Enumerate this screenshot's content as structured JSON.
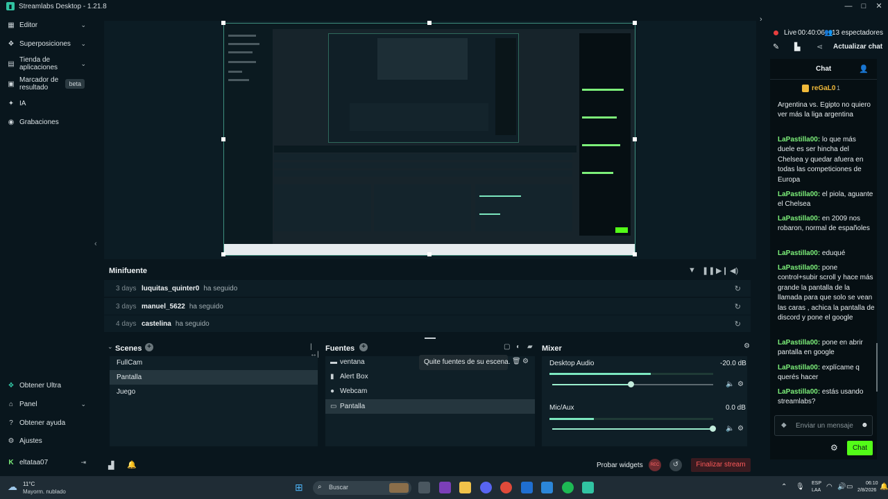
{
  "app": {
    "title": "Streamlabs Desktop - 1.21.8",
    "window_controls": {
      "minimize": "—",
      "maximize": "□",
      "close": "✕"
    }
  },
  "sidebar": {
    "items": [
      {
        "label": "Editor",
        "icon": "grid-icon",
        "glyph": "▦",
        "chevron": "⌄"
      },
      {
        "label": "Superposiciones",
        "icon": "layers-icon",
        "glyph": "❖",
        "chevron": "⌄"
      },
      {
        "label": "Tienda de aplicaciones",
        "icon": "store-icon",
        "glyph": "▤",
        "chevron": "⌄"
      },
      {
        "label": "Marcador de resultado",
        "icon": "highlight-icon",
        "glyph": "▣",
        "badge": "beta"
      },
      {
        "label": "IA",
        "icon": "sparkle-icon",
        "glyph": "✦"
      },
      {
        "label": "Grabaciones",
        "icon": "record-icon",
        "glyph": "◉"
      }
    ],
    "bottom_items": [
      {
        "label": "Obtener Ultra",
        "icon": "ultra-icon",
        "glyph": "❖"
      },
      {
        "label": "Panel",
        "icon": "dashboard-icon",
        "glyph": "⌂",
        "chevron": "⌄"
      },
      {
        "label": "Obtener ayuda",
        "icon": "help-icon",
        "glyph": "?"
      },
      {
        "label": "Ajustes",
        "icon": "gear-icon",
        "glyph": "⚙"
      }
    ],
    "user": {
      "name": "eltataa07",
      "logout_glyph": "⇥"
    }
  },
  "minifeed": {
    "title": "Minifuente",
    "rows": [
      {
        "ago": "3 days",
        "user": "luquitas_quinter0",
        "action": "ha seguido"
      },
      {
        "ago": "3 days",
        "user": "manuel_5622",
        "action": "ha seguido"
      },
      {
        "ago": "4 days",
        "user": "castelina",
        "action": "ha seguido"
      }
    ]
  },
  "scenes": {
    "title": "Scenes",
    "items": [
      "FullCam",
      "Pantalla",
      "Juego"
    ],
    "selected": "Pantalla"
  },
  "sources": {
    "title": "Fuentes",
    "items": [
      {
        "label": "ventana",
        "icon": "window-icon",
        "glyph": "▬"
      },
      {
        "label": "Alert Box",
        "icon": "alertbox-icon",
        "glyph": "▮"
      },
      {
        "label": "Webcam",
        "icon": "webcam-icon",
        "glyph": "●"
      },
      {
        "label": "Pantalla",
        "icon": "monitor-icon",
        "glyph": "▭"
      }
    ],
    "selected": "Pantalla",
    "tooltip": "Quite fuentes de su escena."
  },
  "mixer": {
    "title": "Mixer",
    "channels": [
      {
        "name": "Desktop Audio",
        "db": "-20.0 dB",
        "level": 0.62,
        "volume": 0.49
      },
      {
        "name": "Mic/Aux",
        "db": "0.0 dB",
        "level": 0.27,
        "volume": 1.0
      }
    ]
  },
  "bottombar": {
    "test_widgets": "Probar widgets",
    "rec": "REC",
    "end_stream": "Finalizar stream"
  },
  "stream": {
    "status": "Live",
    "time": "00:40:06",
    "viewers": "13 espectadores",
    "refresh_chat": "Actualizar chat"
  },
  "chat": {
    "title": "Chat",
    "pinned_user": "reGaL0",
    "pinned_count": "1",
    "pinned_text": "Argentina vs. Egipto no quiero ver más la liga argentina",
    "messages": [
      {
        "nick": "LaPastilla00:",
        "text": " lo que más duele es ser hincha del Chelsea y quedar afuera en todas las competiciones de Europa"
      },
      {
        "nick": "LaPastilla00:",
        "text": " el piola, aguante el Chelsea"
      },
      {
        "nick": "LaPastilla00:",
        "text": " en 2009 nos robaron, normal de españoles"
      },
      {
        "nick": "LaPastilla00:",
        "text": " eduqué"
      },
      {
        "nick": "LaPastilla00:",
        "text": " pone control+subir scroll y hace más grande la pantalla de la llamada para que solo se vean las caras , achica la pantalla de discord y pone el google"
      },
      {
        "nick": "LaPastilla00:",
        "text": " pone en abrir pantalla en google"
      },
      {
        "nick": "LaPastilla00:",
        "text": " explícame q querés hacer"
      },
      {
        "nick": "LaPastilla00:",
        "text": " estás usando streamlabs?"
      }
    ],
    "input_placeholder": "Enviar un mensaje",
    "send": "Chat"
  },
  "taskbar": {
    "weather_temp": "11°C",
    "weather_desc": "Mayorm. nublado",
    "search": "Buscar",
    "lang1": "ESP",
    "lang2": "LAA",
    "time": "06:10",
    "date": "2/8/2026"
  },
  "colors": {
    "accent": "#31c3a2",
    "live_red": "#e83e3e",
    "chat_nick": "#7df07a",
    "end_stream": "#ff5a5a"
  }
}
